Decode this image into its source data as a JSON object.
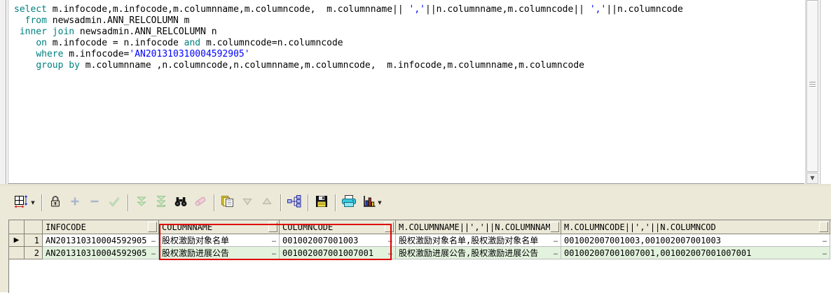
{
  "editor": {
    "sql_lines": [
      {
        "segments": [
          {
            "type": "keyword",
            "text": "select"
          },
          {
            "type": "id",
            "text": " m.infocode,m.infocode,m.columnname,m.columncode,  m.columnname|| "
          },
          {
            "type": "str",
            "text": "','"
          },
          {
            "type": "id",
            "text": "||n.columnname,m.columncode|| "
          },
          {
            "type": "str",
            "text": "','"
          },
          {
            "type": "id",
            "text": "||n.columncode"
          }
        ]
      },
      {
        "segments": [
          {
            "type": "id",
            "text": "  "
          },
          {
            "type": "keyword",
            "text": "from"
          },
          {
            "type": "id",
            "text": " newsadmin.ANN_RELCOLUMN m"
          }
        ]
      },
      {
        "segments": [
          {
            "type": "id",
            "text": " "
          },
          {
            "type": "keyword",
            "text": "inner join"
          },
          {
            "type": "id",
            "text": " newsadmin.ANN_RELCOLUMN n"
          }
        ]
      },
      {
        "segments": [
          {
            "type": "id",
            "text": "    "
          },
          {
            "type": "keyword",
            "text": "on"
          },
          {
            "type": "id",
            "text": " m.infocode = n.infocode "
          },
          {
            "type": "keyword",
            "text": "and"
          },
          {
            "type": "id",
            "text": " m.columncode=n.columncode"
          }
        ]
      },
      {
        "segments": [
          {
            "type": "id",
            "text": "    "
          },
          {
            "type": "keyword",
            "text": "where"
          },
          {
            "type": "id",
            "text": " m.infocode="
          },
          {
            "type": "str",
            "text": "'AN201310310004592905'"
          }
        ]
      },
      {
        "segments": [
          {
            "type": "id",
            "text": "    "
          },
          {
            "type": "keyword",
            "text": "group by"
          },
          {
            "type": "id",
            "text": " m.columnname ,n.columncode,n.columnname,m.columncode,  m.infocode,m.columnname,m.columncode"
          }
        ]
      }
    ],
    "scrollbar_down_glyph": "▼"
  },
  "toolbar": {
    "dropdown_glyph": "▼",
    "groups": [
      {
        "buttons": [
          {
            "name": "grid-mode",
            "icon": "grid-icon",
            "enabled": true,
            "dropdown": true
          }
        ]
      },
      {
        "buttons": [
          {
            "name": "lock-records",
            "icon": "lock-icon",
            "enabled": true
          },
          {
            "name": "insert-record",
            "icon": "plus-icon",
            "enabled": false
          },
          {
            "name": "delete-record",
            "icon": "minus-icon",
            "enabled": false
          },
          {
            "name": "post-changes",
            "icon": "check-icon",
            "enabled": false
          }
        ]
      },
      {
        "buttons": [
          {
            "name": "fetch-next-page",
            "icon": "chevrons-down-icon",
            "enabled": false
          },
          {
            "name": "fetch-last-page",
            "icon": "chevrons-down-line-icon",
            "enabled": false
          },
          {
            "name": "find",
            "icon": "binoculars-icon",
            "enabled": true
          },
          {
            "name": "highlight-eraser",
            "icon": "eraser-icon",
            "enabled": false
          }
        ]
      },
      {
        "buttons": [
          {
            "name": "copy-results",
            "icon": "copy-icon",
            "enabled": true
          },
          {
            "name": "previous-result",
            "icon": "triangle-down-icon",
            "enabled": false
          },
          {
            "name": "next-result",
            "icon": "triangle-up-icon",
            "enabled": false
          }
        ]
      },
      {
        "buttons": [
          {
            "name": "linked-query",
            "icon": "tree-icon",
            "enabled": true
          }
        ]
      },
      {
        "buttons": [
          {
            "name": "save-results",
            "icon": "floppy-icon",
            "enabled": true
          }
        ]
      },
      {
        "buttons": [
          {
            "name": "print-results",
            "icon": "printer-icon",
            "enabled": true
          },
          {
            "name": "chart-results",
            "icon": "chart-icon",
            "enabled": true,
            "dropdown": true
          }
        ]
      }
    ]
  },
  "grid": {
    "columns": [
      "INFOCODE",
      "COLUMNNAME",
      "COLUMNCODE",
      "M.COLUMNNAME||','||N.COLUMNNAM",
      "M.COLUMNCODE||','||N.COLUMNCOD"
    ],
    "rows": [
      {
        "num": "1",
        "selected": true,
        "cells": [
          "AN201310310004592905",
          "股权激励对象名单",
          "001002007001003",
          "股权激励对象名单,股权激励对象名单",
          "001002007001003,001002007001003"
        ]
      },
      {
        "num": "2",
        "selected": false,
        "cells": [
          "AN201310310004592905",
          "股权激励进展公告",
          "001002007001007001",
          "股权激励进展公告,股权激励进展公告",
          "001002007001007001,001002007001007001"
        ]
      }
    ],
    "indicator_glyph": "▶",
    "cell_ellipsis_glyph": "…"
  },
  "annotation": {
    "rectangle_color": "#dd0000"
  },
  "colors": {
    "keyword": "#008080",
    "string_literal": "#0000ff",
    "panel_background": "#ece9d8",
    "row_even_background": "#e2f2dd",
    "row_odd_background": "#ffffff"
  }
}
